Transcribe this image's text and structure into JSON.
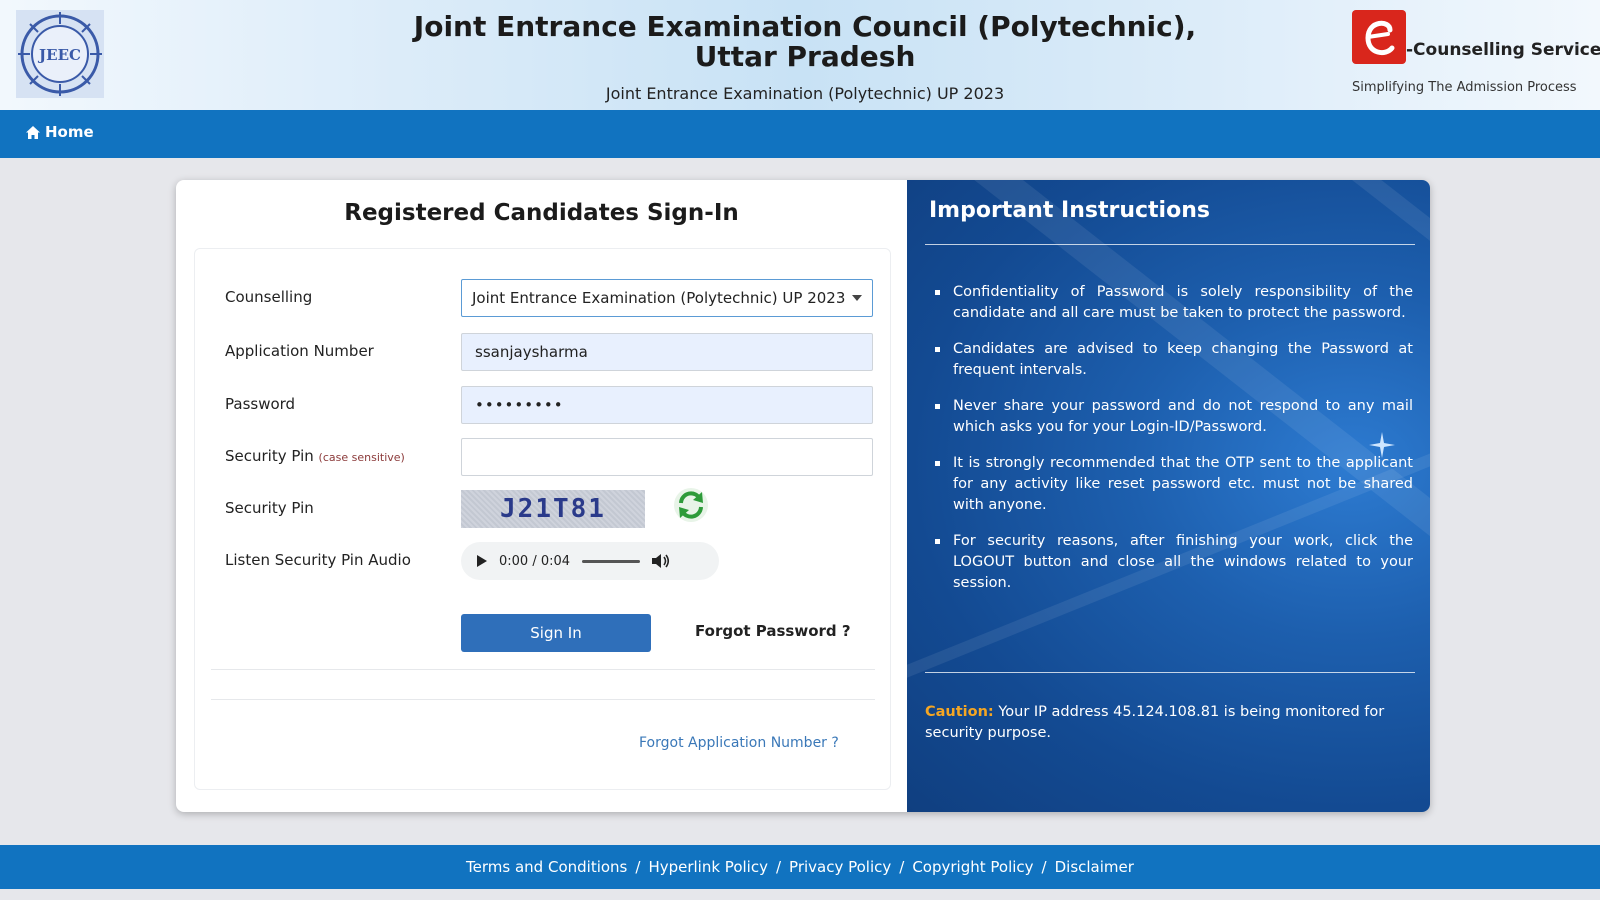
{
  "header": {
    "title": "Joint Entrance Examination Council (Polytechnic), Uttar Pradesh",
    "subtitle": "Joint Entrance Examination (Polytechnic) UP 2023",
    "logo_text": "JEEC",
    "brand_name": "-Counselling Services",
    "brand_tagline": "Simplifying The Admission Process"
  },
  "nav": {
    "home_label": "Home"
  },
  "form": {
    "title": "Registered Candidates Sign-In",
    "counselling_label": "Counselling",
    "counselling_value": "Joint Entrance Examination (Polytechnic) UP 2023",
    "application_label": "Application Number",
    "application_value": "ssanjaysharma",
    "password_label": "Password",
    "password_value": "•••••••••",
    "security_pin_label": "Security Pin",
    "case_sensitive_note": "(case sensitive)",
    "security_pin_value": "",
    "captcha_label": "Security Pin",
    "captcha_text": "J21T81",
    "audio_label": "Listen Security Pin Audio",
    "audio_time": "0:00 / 0:04",
    "signin_label": "Sign In",
    "forgot_password_label": "Forgot Password ?",
    "forgot_application_label": "Forgot Application Number ?"
  },
  "instructions": {
    "title": "Important Instructions",
    "items": [
      "Confidentiality of Password is solely responsibility of the candidate and all care must be taken to protect the password.",
      "Candidates are advised to keep changing the Password at frequent intervals.",
      "Never share your password and do not respond to any mail which asks you for your Login-ID/Password.",
      "It is strongly recommended that the OTP sent to the applicant for any activity like reset password etc. must not be shared with anyone.",
      "For security reasons, after finishing your work, click the LOGOUT button and close all the windows related to your session."
    ],
    "caution_label": "Caution:",
    "caution_text": " Your IP address 45.124.108.81 is being monitored for security purpose."
  },
  "footer": {
    "links": [
      "Terms and Conditions",
      "Hyperlink Policy",
      "Privacy Policy",
      "Copyright Policy",
      "Disclaimer"
    ],
    "separator": "/"
  },
  "colors": {
    "nav_blue": "#1173c0",
    "signin_button": "#2f6fba",
    "instructions_panel": "#1d5fae",
    "caution_orange": "#f5a623",
    "brand_red": "#d9261c"
  }
}
